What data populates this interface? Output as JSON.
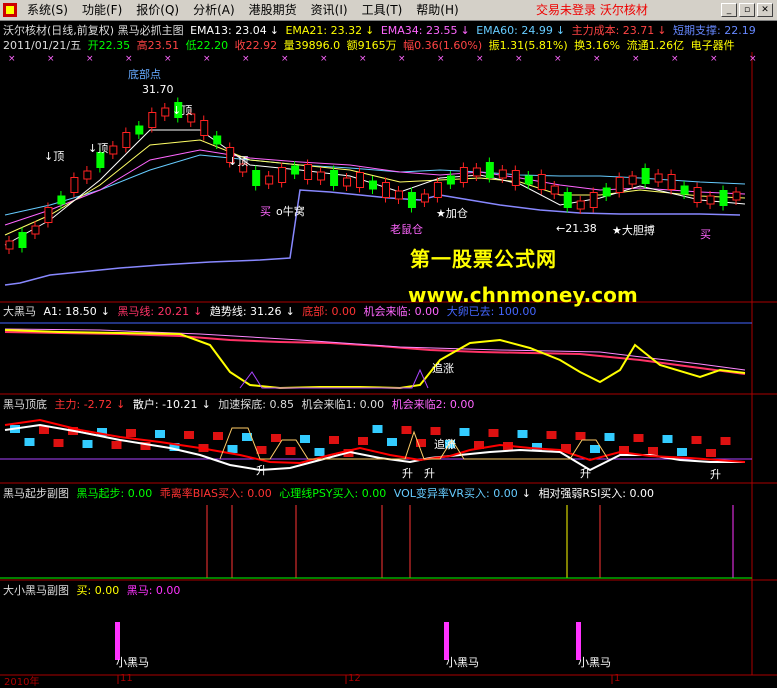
{
  "menubar": {
    "items": [
      "系统(S)",
      "功能(F)",
      "报价(Q)",
      "分析(A)",
      "港股期货",
      "资讯(I)",
      "工具(T)",
      "帮助(H)"
    ],
    "status": "交易未登录  沃尔核材"
  },
  "main_header": {
    "title": "沃尔核材(日线,前复权) 黑马必抓主图",
    "ema13": "EMA13: 23.04",
    "ema21": "EMA21: 23.32",
    "ema34": "EMA34: 23.55",
    "ema60": "EMA60: 24.99",
    "main_cost": "主力成本: 23.71",
    "short_support": "短期支撑: 22.19",
    "date": "2011/01/21/五",
    "open": "开22.35",
    "high": "高23.51",
    "low": "低22.20",
    "close": "收22.92",
    "volume": "量39896.0",
    "amount": "额9165万",
    "change": "幅0.36(1.60%)",
    "amplitude": "振1.31(5.81%)",
    "turnover": "换3.16%",
    "float_shares": "流通1.26亿",
    "sector": "电子器件"
  },
  "annotations": {
    "bottom_point": "底部点",
    "price_high": "31.70",
    "price_low": "←21.38",
    "top": "顶",
    "buy": "买",
    "ox_pot": "牛窝",
    "add_position": "加仓",
    "rat_position": "老鼠仓",
    "bold_fight": "大胆搏",
    "chase": "追涨",
    "rise": "升",
    "small_horse": "小黑马"
  },
  "panel_heima": {
    "name": "大黑马",
    "a1": "A1: 18.50",
    "heima_line": "黑马线: 20.21",
    "trend_line": "趋势线: 31.26",
    "bottom": "底部: 0.00",
    "chance": "机会来临: 0.00",
    "big_egg": "大卵已去: 100.00"
  },
  "panel_top_bottom": {
    "name": "黑马顶底",
    "main_force": "主力: -2.72",
    "retail": "散户: -10.21",
    "accel": "加速探底: 0.85",
    "chance1": "机会来临1: 0.00",
    "chance2": "机会来临2: 0.00"
  },
  "panel_start": {
    "name": "黑马起步副图",
    "start": "黑马起步: 0.00",
    "bias": "乖离率BIAS买入: 0.00",
    "psy": "心理线PSY买入: 0.00",
    "vr": "VOL变异率VR买入: 0.00",
    "rsi": "相对强弱RSI买入: 0.00"
  },
  "panel_small": {
    "name": "大小黑马副图",
    "buy": "买: 0.00",
    "heima": "黑马: 0.00"
  },
  "watermark": {
    "cn": "第一股票公式网",
    "en": "www.chnmoney.com"
  },
  "axis": {
    "labels": [
      "2010年",
      "11",
      "12",
      "1"
    ]
  }
}
